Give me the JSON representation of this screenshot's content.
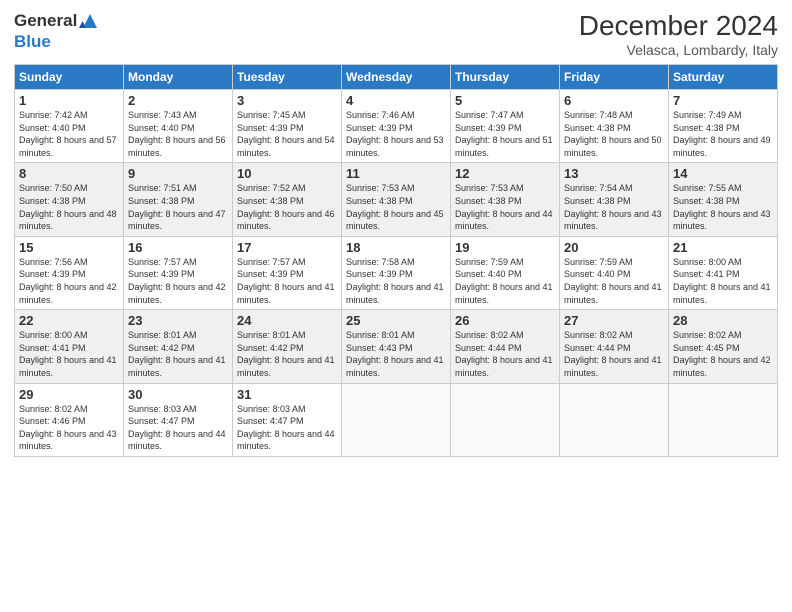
{
  "header": {
    "logo_general": "General",
    "logo_blue": "Blue",
    "month_year": "December 2024",
    "location": "Velasca, Lombardy, Italy"
  },
  "weekdays": [
    "Sunday",
    "Monday",
    "Tuesday",
    "Wednesday",
    "Thursday",
    "Friday",
    "Saturday"
  ],
  "weeks": [
    [
      {
        "day": "1",
        "sunrise": "Sunrise: 7:42 AM",
        "sunset": "Sunset: 4:40 PM",
        "daylight": "Daylight: 8 hours and 57 minutes."
      },
      {
        "day": "2",
        "sunrise": "Sunrise: 7:43 AM",
        "sunset": "Sunset: 4:40 PM",
        "daylight": "Daylight: 8 hours and 56 minutes."
      },
      {
        "day": "3",
        "sunrise": "Sunrise: 7:45 AM",
        "sunset": "Sunset: 4:39 PM",
        "daylight": "Daylight: 8 hours and 54 minutes."
      },
      {
        "day": "4",
        "sunrise": "Sunrise: 7:46 AM",
        "sunset": "Sunset: 4:39 PM",
        "daylight": "Daylight: 8 hours and 53 minutes."
      },
      {
        "day": "5",
        "sunrise": "Sunrise: 7:47 AM",
        "sunset": "Sunset: 4:39 PM",
        "daylight": "Daylight: 8 hours and 51 minutes."
      },
      {
        "day": "6",
        "sunrise": "Sunrise: 7:48 AM",
        "sunset": "Sunset: 4:38 PM",
        "daylight": "Daylight: 8 hours and 50 minutes."
      },
      {
        "day": "7",
        "sunrise": "Sunrise: 7:49 AM",
        "sunset": "Sunset: 4:38 PM",
        "daylight": "Daylight: 8 hours and 49 minutes."
      }
    ],
    [
      {
        "day": "8",
        "sunrise": "Sunrise: 7:50 AM",
        "sunset": "Sunset: 4:38 PM",
        "daylight": "Daylight: 8 hours and 48 minutes."
      },
      {
        "day": "9",
        "sunrise": "Sunrise: 7:51 AM",
        "sunset": "Sunset: 4:38 PM",
        "daylight": "Daylight: 8 hours and 47 minutes."
      },
      {
        "day": "10",
        "sunrise": "Sunrise: 7:52 AM",
        "sunset": "Sunset: 4:38 PM",
        "daylight": "Daylight: 8 hours and 46 minutes."
      },
      {
        "day": "11",
        "sunrise": "Sunrise: 7:53 AM",
        "sunset": "Sunset: 4:38 PM",
        "daylight": "Daylight: 8 hours and 45 minutes."
      },
      {
        "day": "12",
        "sunrise": "Sunrise: 7:53 AM",
        "sunset": "Sunset: 4:38 PM",
        "daylight": "Daylight: 8 hours and 44 minutes."
      },
      {
        "day": "13",
        "sunrise": "Sunrise: 7:54 AM",
        "sunset": "Sunset: 4:38 PM",
        "daylight": "Daylight: 8 hours and 43 minutes."
      },
      {
        "day": "14",
        "sunrise": "Sunrise: 7:55 AM",
        "sunset": "Sunset: 4:38 PM",
        "daylight": "Daylight: 8 hours and 43 minutes."
      }
    ],
    [
      {
        "day": "15",
        "sunrise": "Sunrise: 7:56 AM",
        "sunset": "Sunset: 4:39 PM",
        "daylight": "Daylight: 8 hours and 42 minutes."
      },
      {
        "day": "16",
        "sunrise": "Sunrise: 7:57 AM",
        "sunset": "Sunset: 4:39 PM",
        "daylight": "Daylight: 8 hours and 42 minutes."
      },
      {
        "day": "17",
        "sunrise": "Sunrise: 7:57 AM",
        "sunset": "Sunset: 4:39 PM",
        "daylight": "Daylight: 8 hours and 41 minutes."
      },
      {
        "day": "18",
        "sunrise": "Sunrise: 7:58 AM",
        "sunset": "Sunset: 4:39 PM",
        "daylight": "Daylight: 8 hours and 41 minutes."
      },
      {
        "day": "19",
        "sunrise": "Sunrise: 7:59 AM",
        "sunset": "Sunset: 4:40 PM",
        "daylight": "Daylight: 8 hours and 41 minutes."
      },
      {
        "day": "20",
        "sunrise": "Sunrise: 7:59 AM",
        "sunset": "Sunset: 4:40 PM",
        "daylight": "Daylight: 8 hours and 41 minutes."
      },
      {
        "day": "21",
        "sunrise": "Sunrise: 8:00 AM",
        "sunset": "Sunset: 4:41 PM",
        "daylight": "Daylight: 8 hours and 41 minutes."
      }
    ],
    [
      {
        "day": "22",
        "sunrise": "Sunrise: 8:00 AM",
        "sunset": "Sunset: 4:41 PM",
        "daylight": "Daylight: 8 hours and 41 minutes."
      },
      {
        "day": "23",
        "sunrise": "Sunrise: 8:01 AM",
        "sunset": "Sunset: 4:42 PM",
        "daylight": "Daylight: 8 hours and 41 minutes."
      },
      {
        "day": "24",
        "sunrise": "Sunrise: 8:01 AM",
        "sunset": "Sunset: 4:42 PM",
        "daylight": "Daylight: 8 hours and 41 minutes."
      },
      {
        "day": "25",
        "sunrise": "Sunrise: 8:01 AM",
        "sunset": "Sunset: 4:43 PM",
        "daylight": "Daylight: 8 hours and 41 minutes."
      },
      {
        "day": "26",
        "sunrise": "Sunrise: 8:02 AM",
        "sunset": "Sunset: 4:44 PM",
        "daylight": "Daylight: 8 hours and 41 minutes."
      },
      {
        "day": "27",
        "sunrise": "Sunrise: 8:02 AM",
        "sunset": "Sunset: 4:44 PM",
        "daylight": "Daylight: 8 hours and 41 minutes."
      },
      {
        "day": "28",
        "sunrise": "Sunrise: 8:02 AM",
        "sunset": "Sunset: 4:45 PM",
        "daylight": "Daylight: 8 hours and 42 minutes."
      }
    ],
    [
      {
        "day": "29",
        "sunrise": "Sunrise: 8:02 AM",
        "sunset": "Sunset: 4:46 PM",
        "daylight": "Daylight: 8 hours and 43 minutes."
      },
      {
        "day": "30",
        "sunrise": "Sunrise: 8:03 AM",
        "sunset": "Sunset: 4:47 PM",
        "daylight": "Daylight: 8 hours and 44 minutes."
      },
      {
        "day": "31",
        "sunrise": "Sunrise: 8:03 AM",
        "sunset": "Sunset: 4:47 PM",
        "daylight": "Daylight: 8 hours and 44 minutes."
      },
      null,
      null,
      null,
      null
    ]
  ]
}
